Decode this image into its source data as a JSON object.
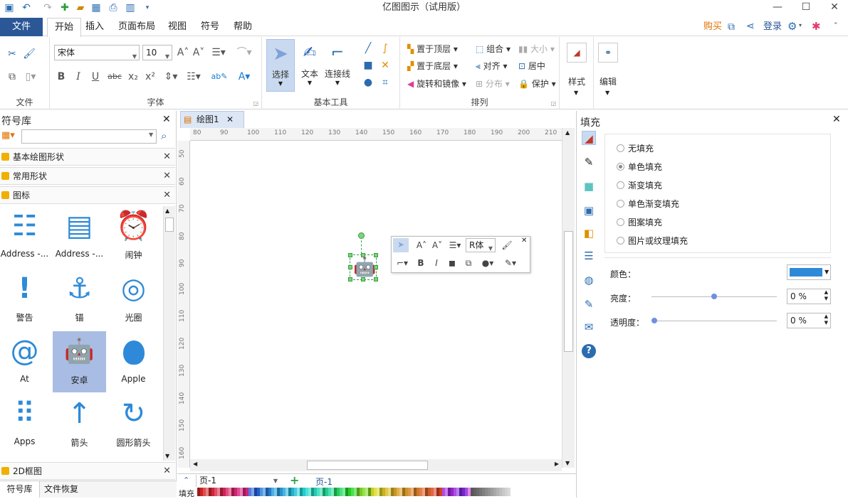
{
  "window": {
    "title": "亿图图示（试用版）"
  },
  "quickaccess": {
    "icons": [
      "app-icon",
      "undo-icon",
      "redo-icon",
      "new-icon",
      "open-icon",
      "save-icon",
      "print-icon",
      "export-icon",
      "customize-icon"
    ]
  },
  "menu": {
    "file": "文件",
    "tabs": [
      "开始",
      "插入",
      "页面布局",
      "视图",
      "符号",
      "帮助"
    ],
    "buy": "购买",
    "login": "登录"
  },
  "ribbon": {
    "file_group": "文件",
    "font_group": "字体",
    "font_name": "宋体",
    "font_size": "10",
    "basic_group": "基本工具",
    "select": "选择",
    "text": "文本",
    "connector": "连接线",
    "arrange_group": "排列",
    "bring_front": "置于顶层",
    "send_back": "置于底层",
    "rotate": "旋转和镜像",
    "group": "组合",
    "align": "对齐",
    "distribute": "分布",
    "size": "大小",
    "center": "居中",
    "protect": "保护",
    "style": "样式",
    "edit": "编辑"
  },
  "library": {
    "title": "符号库",
    "categories": [
      "基本绘图形状",
      "常用形状",
      "图标"
    ],
    "bottom_category": "2D框图",
    "tiles": [
      {
        "label": "Address -...",
        "glyph": "☷"
      },
      {
        "label": "Address -...",
        "glyph": "▤"
      },
      {
        "label": "闹钟",
        "glyph": "⏰"
      },
      {
        "label": "警告",
        "glyph": "!"
      },
      {
        "label": "锚",
        "glyph": "⚓"
      },
      {
        "label": "光圈",
        "glyph": "◎"
      },
      {
        "label": "At",
        "glyph": "@"
      },
      {
        "label": "安卓",
        "glyph": "🤖"
      },
      {
        "label": "Apple",
        "glyph": ""
      },
      {
        "label": "Apps",
        "glyph": "⠿"
      },
      {
        "label": "箭头",
        "glyph": "↑"
      },
      {
        "label": "圆形箭头",
        "glyph": "↻"
      }
    ],
    "tabs": [
      "符号库",
      "文件恢复"
    ]
  },
  "document": {
    "tab": "绘图1",
    "hruler": [
      "80",
      "90",
      "100",
      "110",
      "120",
      "130",
      "140",
      "150",
      "160",
      "170",
      "180",
      "190",
      "200",
      "210"
    ],
    "vruler": [
      "50",
      "60",
      "70",
      "80",
      "90",
      "100",
      "110",
      "120",
      "130",
      "140",
      "150",
      "160"
    ],
    "mini_font": "R体",
    "page_select": "页-1",
    "page_tab": "页-1",
    "fill_label": "填充"
  },
  "fill_panel": {
    "title": "填充",
    "options": [
      "无填充",
      "单色填充",
      "渐变填充",
      "单色渐变填充",
      "图案填充",
      "图片或纹理填充"
    ],
    "selected": 1,
    "color_label": "颜色：",
    "color_value": "#2e8ad8",
    "brightness_label": "亮度：",
    "brightness_value": "0 %",
    "transparency_label": "透明度：",
    "transparency_value": "0 %"
  }
}
